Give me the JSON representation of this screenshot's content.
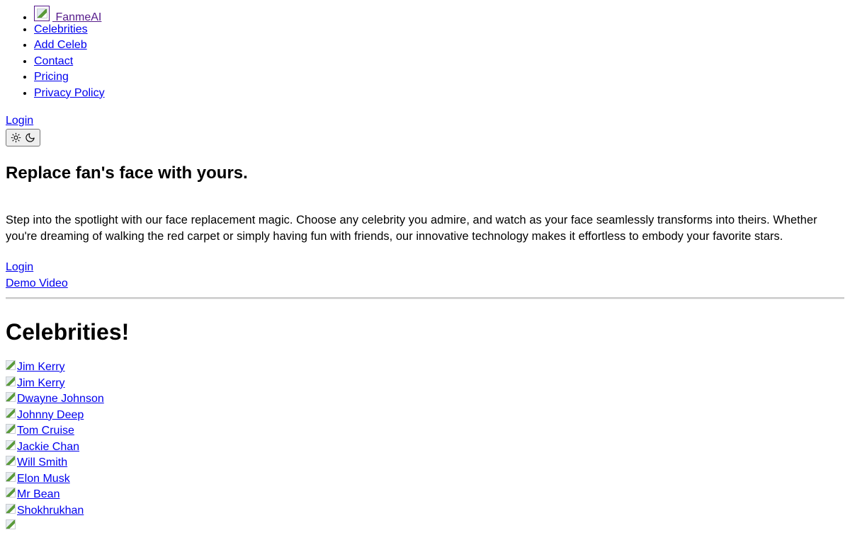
{
  "nav": {
    "brand": {
      "label": "FanmeAI",
      "logo_icon": "broken-image-icon"
    },
    "items": [
      {
        "label": "Celebrities"
      },
      {
        "label": "Add Celeb"
      },
      {
        "label": "Contact"
      },
      {
        "label": "Pricing"
      },
      {
        "label": "Privacy Policy"
      }
    ]
  },
  "header": {
    "login_label": "Login",
    "theme_toggle": {
      "icons": [
        "sun-icon",
        "moon-icon"
      ]
    }
  },
  "hero": {
    "title": "Replace fan's face with yours.",
    "description": "Step into the spotlight with our face replacement magic. Choose any celebrity you admire, and watch as your face seamlessly transforms into theirs. Whether you're dreaming of walking the red carpet or simply having fun with friends, our innovative technology makes it effortless to embody your favorite stars.",
    "login_label": "Login",
    "demo_label": "Demo Video"
  },
  "celebrities": {
    "title": "Celebrities!",
    "items": [
      {
        "name": "Jim Kerry"
      },
      {
        "name": "Jim Kerry"
      },
      {
        "name": "Dwayne Johnson"
      },
      {
        "name": "Johnny Deep"
      },
      {
        "name": "Tom Cruise"
      },
      {
        "name": "Jackie Chan"
      },
      {
        "name": "Will Smith"
      },
      {
        "name": "Elon Musk"
      },
      {
        "name": "Mr Bean"
      },
      {
        "name": "Shokhrukhan"
      },
      {
        "name": ""
      }
    ]
  },
  "colors": {
    "link": "#0000ee",
    "visited_link": "#551a8b",
    "text": "#000000",
    "background": "#ffffff"
  }
}
